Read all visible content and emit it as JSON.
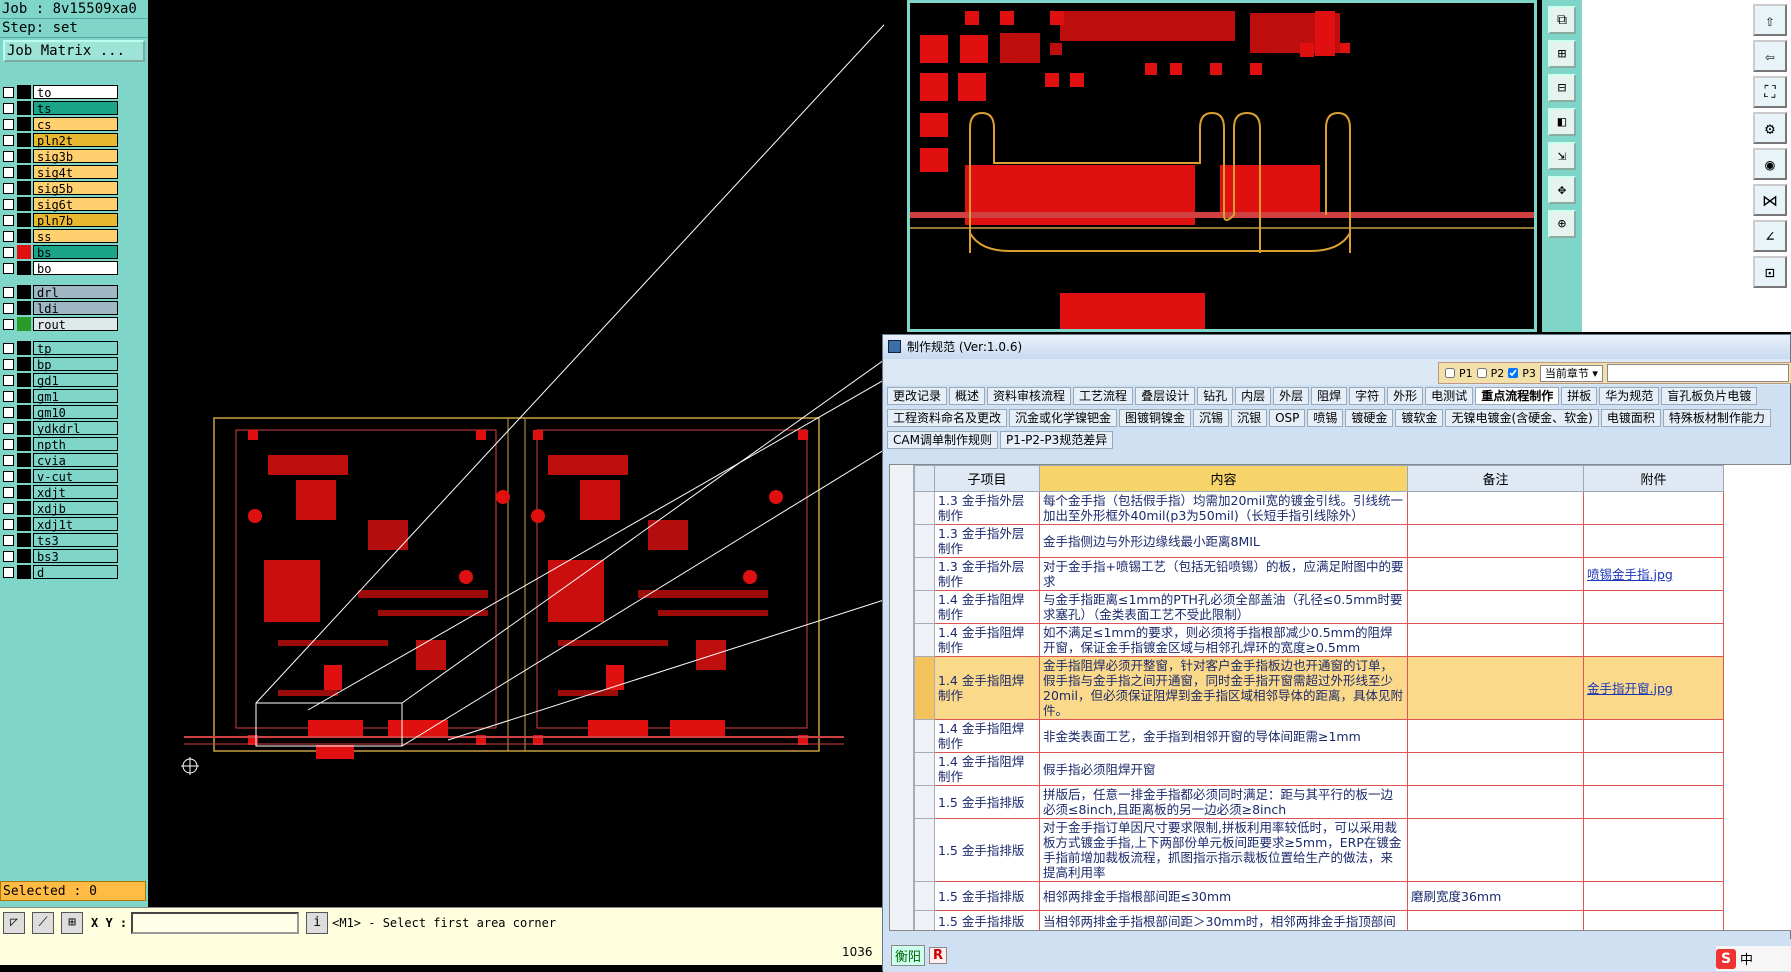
{
  "left_panel": {
    "job": "Job : 8v15509xa0",
    "step": "Step: set",
    "job_matrix": "Job Matrix ...",
    "layers": [
      {
        "name": "to",
        "color": "#ffffff"
      },
      {
        "name": "ts",
        "color": "#1aa58a"
      },
      {
        "name": "cs",
        "color": "#ffd070"
      },
      {
        "name": "pln2t",
        "color": "#e8b830"
      },
      {
        "name": "sig3b",
        "color": "#ffd070"
      },
      {
        "name": "sig4t",
        "color": "#ffd070"
      },
      {
        "name": "sig5b",
        "color": "#ffd070"
      },
      {
        "name": "sig6t",
        "color": "#ffd070"
      },
      {
        "name": "pln7b",
        "color": "#e8b830"
      },
      {
        "name": "ss",
        "color": "#ffd070"
      },
      {
        "name": "bs",
        "color": "#1aa58a"
      },
      {
        "name": "bo",
        "color": "#ffffff"
      }
    ],
    "drill_layers": [
      {
        "name": "drl",
        "color": "#9fb7c4"
      },
      {
        "name": "ldi",
        "color": "#9fb7c4"
      },
      {
        "name": "rout",
        "color": "#dfe9e9"
      }
    ],
    "other_layers": [
      "tp",
      "bp",
      "gd1",
      "gm1",
      "gm10",
      "ydkdrl",
      "npth",
      "cvia",
      "v-cut",
      "xdjt",
      "xdjb",
      "xdj1t",
      "ts3",
      "bs3",
      "d"
    ],
    "selected": "Selected : 0"
  },
  "bottom_bar": {
    "xy_label": "X Y :",
    "xy_value": "",
    "prompt": "<M1> - Select first area corner",
    "counter": "1036"
  },
  "spec_window": {
    "title": "制作规范 (Ver:1.0.6)",
    "filters": {
      "p1": "P1",
      "p2": "P2",
      "p3": "P3",
      "chapter": "当前章节"
    },
    "tabs_row1": [
      "更改记录",
      "概述",
      "资料审核流程",
      "工艺流程",
      "叠层设计",
      "钻孔",
      "内层",
      "外层",
      "阻焊",
      "字符",
      "外形",
      "电测试",
      "重点流程制作",
      "拼板",
      "华为规范",
      "盲孔板负片电镀"
    ],
    "active_tab": "重点流程制作",
    "tabs_row2": [
      "工程资料命名及更改",
      "沉金或化学镍钯金",
      "图镀铜镍金",
      "沉锡",
      "沉银",
      "OSP",
      "喷锡",
      "镀硬金",
      "镀软金",
      "无镍电镀金(含硬金、软金)",
      "电镀面积",
      "特殊板材制作能力"
    ],
    "tabs_row3": [
      "CAM调单制作规则",
      "P1-P2-P3规范差异"
    ],
    "columns": [
      "子项目",
      "内容",
      "备注",
      "附件"
    ],
    "rows": [
      {
        "sub": "1.3 金手指外层制作",
        "content": "每个金手指（包括假手指）均需加20mil宽的镀金引线。引线统一加出至外形框外40mil(p3为50mil)（长短手指引线除外）",
        "note": "",
        "att": ""
      },
      {
        "sub": "1.3 金手指外层制作",
        "content": "金手指侧边与外形边缘线最小距离8MIL",
        "note": "",
        "att": ""
      },
      {
        "sub": "1.3 金手指外层制作",
        "content": "对于金手指+喷锡工艺（包括无铅喷锡）的板，应满足附图中的要求",
        "note": "",
        "att": "喷锡金手指.jpg"
      },
      {
        "sub": "1.4 金手指阻焊制作",
        "content": "与金手指距离≤1mm的PTH孔必须全部盖油（孔径≤0.5mm时要求塞孔）（金类表面工艺不受此限制）",
        "note": "",
        "att": ""
      },
      {
        "sub": "1.4 金手指阻焊制作",
        "content": "如不满足≤1mm的要求，则必须将手指根部减少0.5mm的阻焊开窗，保证金手指镀金区域与相邻孔焊环的宽度≥0.5mm",
        "note": "",
        "att": ""
      },
      {
        "sub": "1.4 金手指阻焊制作",
        "content": "金手指阻焊必须开整窗，针对客户金手指板边也开通窗的订单，假手指与金手指之间开通窗，同时金手指开窗需超过外形线至少20mil，但必须保证阻焊到金手指区域相邻导体的距离，具体见附件。",
        "note": "",
        "att": "金手指开窗.jpg",
        "selected": true
      },
      {
        "sub": "1.4 金手指阻焊制作",
        "content": "非金类表面工艺，金手指到相邻开窗的导体间距需≥1mm",
        "note": "",
        "att": ""
      },
      {
        "sub": "1.4 金手指阻焊制作",
        "content": "假手指必须阻焊开窗",
        "note": "",
        "att": ""
      },
      {
        "sub": "1.5 金手指排版",
        "content": "拼版后，任意一排金手指都必须同时满足：距与其平行的板一边必须≤8inch,且距离板的另一边必须≥8inch",
        "note": "",
        "att": ""
      },
      {
        "sub": "1.5 金手指排版",
        "content": "对于金手指订单因尺寸要求限制,拼板利用率较低时，可以采用裁板方式镀金手指,上下两部份单元板间距要求≥5mm，ERP在镀金手指前增加裁板流程，抓图指示指示裁板位置给生产的做法，来提高利用率",
        "note": "",
        "att": ""
      },
      {
        "sub": "1.5 金手指排版",
        "content": "相邻两排金手指根部间距≤30mm",
        "note": "磨刷宽度36mm",
        "att": ""
      },
      {
        "sub": "1.5 金手指排版",
        "content": "当相邻两排金手指根部间距＞30mm时，相邻两排金手指顶部间",
        "note": "",
        "att": ""
      }
    ],
    "footer": {
      "a": "衡阳",
      "b": "R"
    }
  },
  "ime": {
    "s": "S",
    "label": "中"
  }
}
